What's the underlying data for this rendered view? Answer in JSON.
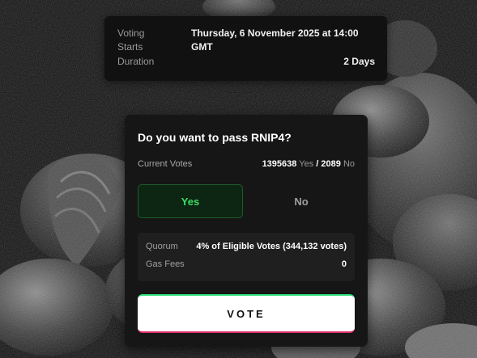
{
  "voting_info": {
    "voting_label": "Voting",
    "starts_label": "Starts",
    "start_value_line1": "Thursday, 6 November 2025 at 14:00",
    "start_value_line2": "GMT",
    "duration_label": "Duration",
    "duration_value": "2 Days"
  },
  "proposal": {
    "question": "Do you want to pass RNIP4?",
    "current_votes_label": "Current Votes",
    "yes_count": "1395638",
    "yes_word": "Yes",
    "separator": "/",
    "no_count": "2089",
    "no_word": "No",
    "choices": {
      "yes_label": "Yes",
      "no_label": "No",
      "selected": "Yes"
    },
    "quorum_label": "Quorum",
    "quorum_value": "4% of Eligible Votes (344,132 votes)",
    "gas_fees_label": "Gas Fees",
    "gas_fees_value": "0",
    "vote_button_label": "VOTE"
  },
  "colors": {
    "yes_accent": "#3cdc64",
    "card_bg": "#161616",
    "vote_button_bg": "#ffffff"
  }
}
